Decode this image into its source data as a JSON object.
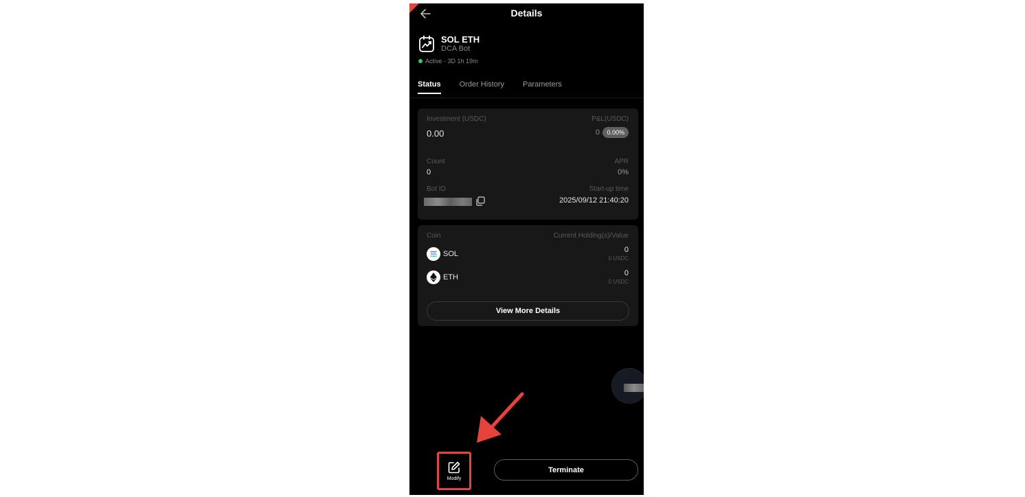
{
  "header": {
    "title": "Details",
    "back_icon": "arrow-left-icon"
  },
  "bot": {
    "pair": "SOL ETH",
    "type": "DCA Bot",
    "status": "Active - 3D 1h 19m",
    "status_color": "#2ecc71"
  },
  "tabs": [
    {
      "label": "Status",
      "active": true
    },
    {
      "label": "Order History",
      "active": false
    },
    {
      "label": "Parameters",
      "active": false
    }
  ],
  "summary": {
    "investment_label": "Investment (USDC)",
    "investment_value": "0.00",
    "pnl_label": "P&L(USDC)",
    "pnl_value": "0",
    "pnl_percent": "0.00%",
    "count_label": "Count",
    "count_value": "0",
    "apr_label": "APR",
    "apr_value": "0%",
    "bot_id_label": "Bot ID",
    "startup_label": "Start-up time",
    "startup_value": "2025/09/12 21:40:20"
  },
  "holdings": {
    "coin_header": "Coin",
    "value_header": "Current Holding(s)/Value",
    "coins": [
      {
        "symbol": "SOL",
        "amount": "0",
        "value": "0 USDC",
        "icon": "solana-icon"
      },
      {
        "symbol": "ETH",
        "amount": "0",
        "value": "0 USDC",
        "icon": "ethereum-icon"
      }
    ],
    "view_more_label": "View More Details"
  },
  "footer": {
    "modify_label": "Modify",
    "terminate_label": "Terminate"
  },
  "colors": {
    "highlight": "#e5433b",
    "background": "#000000",
    "card": "#181818"
  }
}
